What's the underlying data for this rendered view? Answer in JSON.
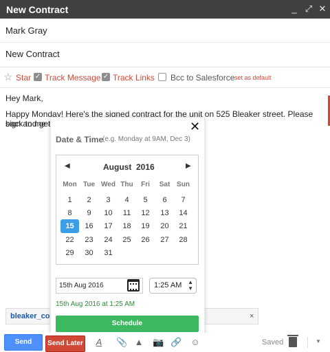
{
  "window": {
    "title": "New Contract",
    "controls": [
      "_",
      "⤢",
      "✕"
    ]
  },
  "to": "Mark Gray",
  "subject": "New Contract",
  "options": {
    "star": "Star",
    "track_message": "Track Message",
    "track_message_checked": true,
    "track_links": "Track Links",
    "track_links_checked": true,
    "bcc_salesforce": "Bcc to Salesforce",
    "bcc_salesforce_checked": false,
    "set_default": "set as default"
  },
  "body": {
    "greeting": "Hey Mark,",
    "line1": "Happy Monday! Here's the signed contract for the unit on 525 Bleaker street. Please sign and get",
    "line2": "back to me as"
  },
  "scheduler": {
    "close": "✕",
    "label": "Date & Time",
    "hint": "(e.g. Monday at 9AM, Dec 3)",
    "prev": "◀",
    "next": "▶",
    "month": "August",
    "year": "2016",
    "weekdays": [
      "Mon",
      "Tue",
      "Wed",
      "Thu",
      "Fri",
      "Sat",
      "Sun"
    ],
    "weeks": [
      [
        "1",
        "2",
        "3",
        "4",
        "5",
        "6",
        "7"
      ],
      [
        "8",
        "9",
        "10",
        "11",
        "12",
        "13",
        "14"
      ],
      [
        "15",
        "16",
        "17",
        "18",
        "19",
        "20",
        "21"
      ],
      [
        "22",
        "23",
        "24",
        "25",
        "26",
        "27",
        "28"
      ],
      [
        "29",
        "30",
        "31",
        "",
        "",
        "",
        ""
      ]
    ],
    "selected_day": "15",
    "date_value": "15th Aug 2016",
    "time_value": "1:25 AM",
    "summary": "15th Aug 2016 at 1:25 AM",
    "schedule_button": "Schedule"
  },
  "attachment": {
    "name": "bleaker_cor",
    "remove": "×"
  },
  "bottombar": {
    "send": "Send",
    "send_later": "Send Later",
    "saved": "Saved",
    "more": "▼"
  },
  "colors": {
    "accent_red": "#d14836",
    "send_blue": "#4d90fe",
    "schedule_green": "#3cb95f",
    "selected_blue": "#3a9ee8"
  }
}
